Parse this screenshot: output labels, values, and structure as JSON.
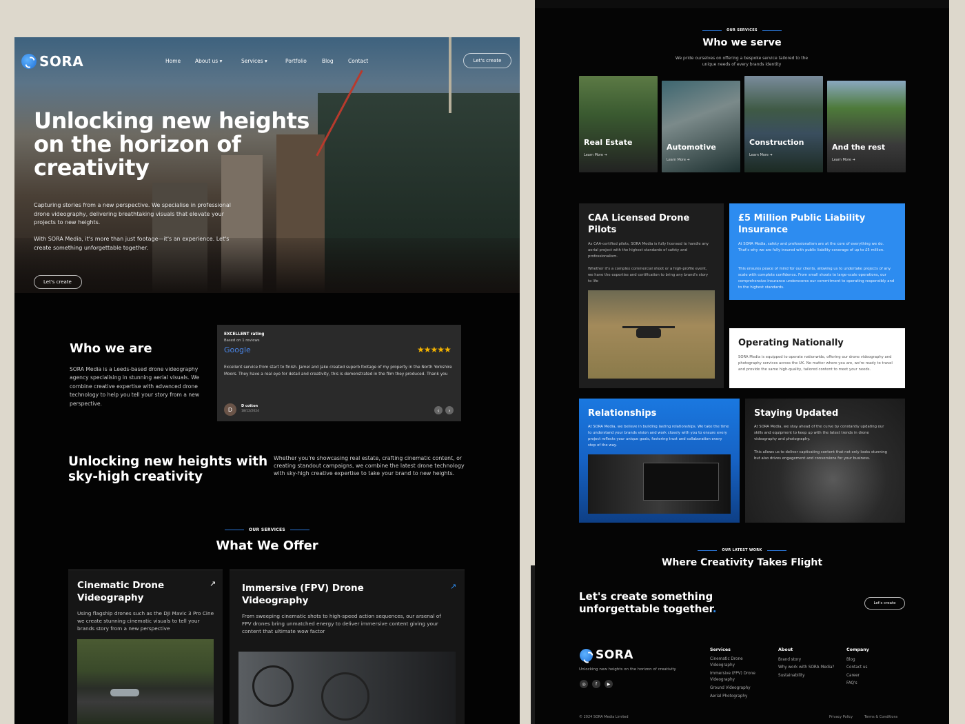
{
  "brand": {
    "name": "SORA"
  },
  "nav": {
    "home": "Home",
    "about": "About us",
    "services": "Services",
    "portfolio": "Portfolio",
    "blog": "Blog",
    "contact": "Contact",
    "cta": "Let's create"
  },
  "hero": {
    "title": "Unlocking new heights on the horizon of creativity",
    "para1": "Capturing stories from a new perspective. We specialise in professional drone videography, delivering breathtaking visuals that elevate your projects to new heights.",
    "para2": "With SORA Media, it's more than just footage—it's an experience. Let's create something unforgettable together.",
    "cta": "Let's create"
  },
  "who": {
    "title": "Who we are",
    "text": "SORA Media is a Leeds-based drone videography agency specialising in stunning aerial visuals. We combine creative expertise with advanced drone technology to help you tell your story from a new perspective."
  },
  "review": {
    "rating_label": "EXCELLENT rating",
    "based_on": "Based on 1 reviews",
    "source": "Google",
    "stars": "★★★★★",
    "text": "Excellent service from start to finish. Jamel and Jake created superb footage of my property in the North Yorkshire Moors. They have a real eye for detail and creativity, this is demonstrated in the film they produced. Thank you",
    "avatar_letter": "D",
    "author": "D cotton",
    "date": "18/12/2024",
    "prev": "‹",
    "next": "›"
  },
  "unlock": {
    "title": "Unlocking new heights with sky-high creativity",
    "text": "Whether you're showcasing real estate, crafting cinematic content, or creating standout campaigns, we combine the latest drone technology with sky-high creative expertise to take your brand to new heights."
  },
  "offer": {
    "eyebrow": "OUR SERVICES",
    "title": "What We Offer",
    "cards": [
      {
        "title": "Cinematic Drone Videography",
        "text": "Using flagship drones such as the DJI Mavic 3 Pro Cine we create stunning cinematic visuals to tell your brands story from a new perspective",
        "icon": "↗"
      },
      {
        "title": "Immersive (FPV) Drone Videography",
        "text": "From sweeping cinematic shots to high-speed action sequences, our arsenal of FPV drones bring unmatched energy to deliver immersive content giving your content that ultimate wow factor",
        "icon": "↗"
      }
    ]
  },
  "serve": {
    "eyebrow": "OUR SERVICES",
    "title": "Who we serve",
    "subtitle": "We pride ourselves on offering a bespoke service tailored to the unique needs of every brands identity",
    "items": [
      {
        "label": "Real Estate",
        "more": "Learn More ➜"
      },
      {
        "label": "Automotive",
        "more": "Learn More ➜"
      },
      {
        "label": "Construction",
        "more": "Learn More ➜"
      },
      {
        "label": "And the rest",
        "more": "Learn More ➜"
      }
    ]
  },
  "features": {
    "caa": {
      "title": "CAA Licensed Drone Pilots",
      "p1": "As CAA-certified pilots, SORA Media is fully licensed to handle any aerial project with the highest standards of safety and professionalism.",
      "p2": "Whether it's a complex commercial shoot or a high-profile event, we have the expertise and certification to bring any brand's story to life"
    },
    "liability": {
      "title": "£5 Million Public Liability Insurance",
      "p1": "At SORA Media, safety and professionalism are at the core of everything we do. That's why we are fully insured with public liability coverage of up to £5 million.",
      "p2": "This ensures peace of mind for our clients, allowing us to undertake projects of any scale with complete confidence. From small shoots to large-scale operations, our comprehensive insurance underscores our commitment to operating responsibly and to the highest standards."
    },
    "national": {
      "title": "Operating Nationally",
      "p1": "SORA Media is equipped to operate nationwide, offering our drone videography and photography services across the UK. No matter where you are, we're ready to travel and provide the same high-quality, tailored content to meet your needs."
    },
    "relationships": {
      "title": "Relationships",
      "p1": "At SORA Media, we believe in building lasting relationships. We take the time to understand your brands vision and work closely with you to ensure every project reflects your unique goals, fostering trust and collaboration every step of the way."
    },
    "updated": {
      "title": "Staying Updated",
      "p1": "At SORA Media, we stay ahead of the curve by constantly updating our skills and equipment to keep up with the latest trends in drone videography and photography.",
      "p2": "This allows us to deliver captivating content that not only looks stunning but also drives engagement and conversions for your business."
    }
  },
  "latest": {
    "eyebrow": "OUR LATEST WORK",
    "title": "Where Creativity Takes Flight"
  },
  "cta_band": {
    "line1": "Let's create something",
    "line2": "unforgettable together",
    "dot": ".",
    "button": "Let's create"
  },
  "footer": {
    "tagline": "Unlocking new heights on the horizon of creativity",
    "socials": [
      "◎",
      "f",
      "▶"
    ],
    "services": {
      "heading": "Services",
      "links": [
        "Cinematic Drone Videography",
        "Immersive (FPV) Drone Videography",
        "Ground Videography",
        "Aerial Photography"
      ]
    },
    "about": {
      "heading": "About",
      "links": [
        "Brand story",
        "Why work with SORA Media?",
        "Sustainability"
      ]
    },
    "company": {
      "heading": "Company",
      "links": [
        "Blog",
        "Contact us",
        "Career",
        "FAQ's"
      ]
    },
    "copyright": "© 2024 SORA Media Limited",
    "privacy": "Privacy Policy",
    "terms": "Terms & Conditions"
  },
  "colors": {
    "accent": "#2d8cf0",
    "background": "#030303",
    "page_bg": "#ddd8cc",
    "star": "#f5b400"
  }
}
